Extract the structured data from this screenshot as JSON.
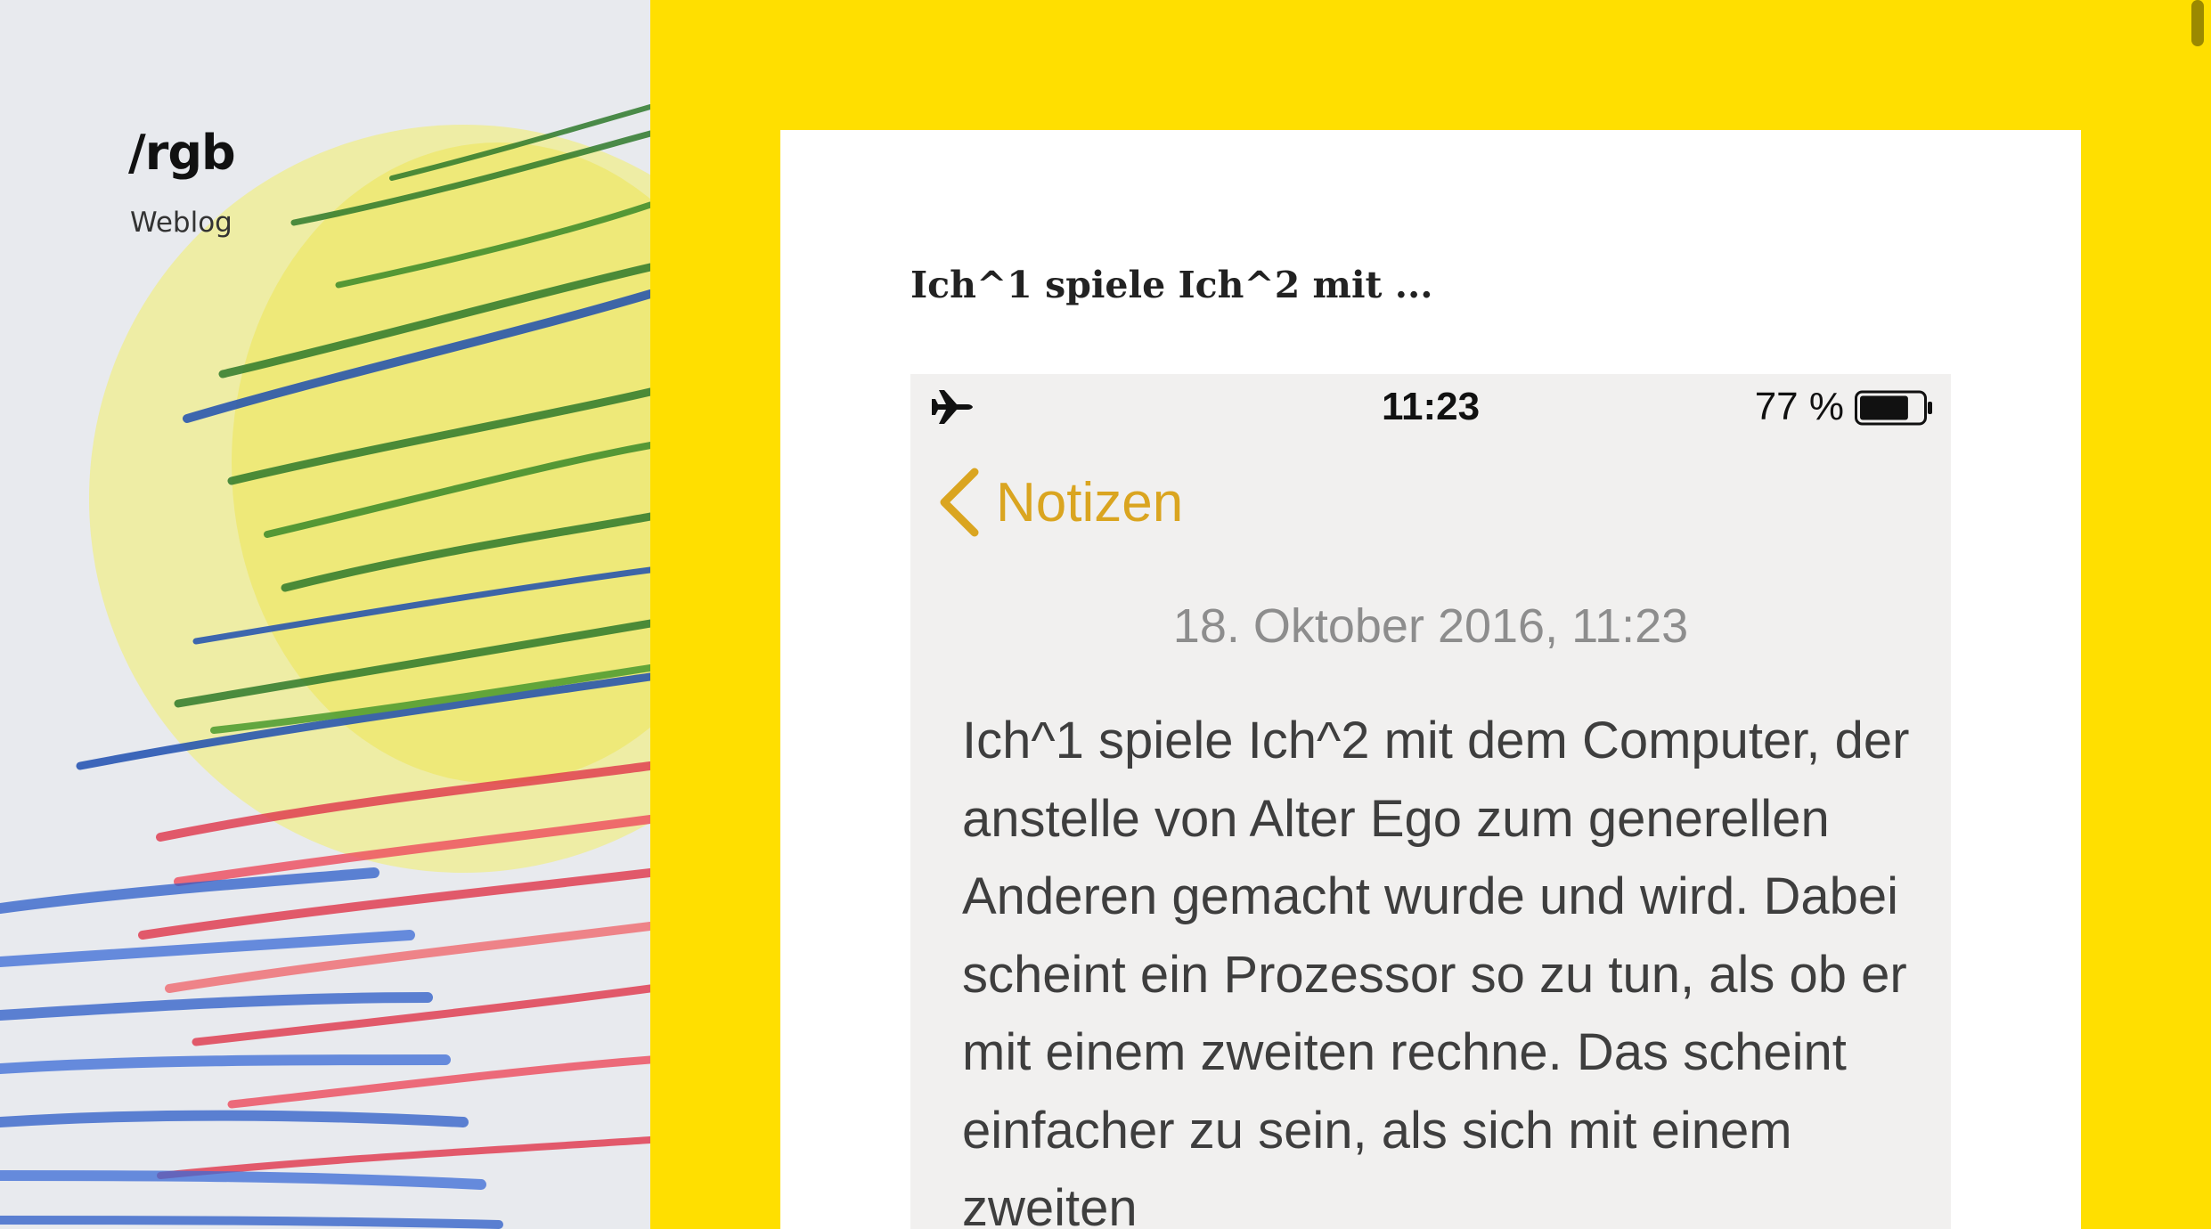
{
  "sidebar": {
    "site_title": "/rgb",
    "site_description": "Weblog"
  },
  "post": {
    "title": "Ich^1 spiele Ich^2 mit ..."
  },
  "phone": {
    "status_bar": {
      "mode_icon": "airplane-icon",
      "time": "11:23",
      "battery_percent": "77 %",
      "battery_icon": "battery-icon",
      "battery_level": 0.77
    },
    "nav": {
      "back_icon": "chevron-left-icon",
      "back_label": "Notizen"
    },
    "note": {
      "date": "18. Oktober 2016, 11:23",
      "body": "Ich^1 spiele Ich^2 mit dem Computer, der anstelle von Alter Ego zum generellen Anderen gemacht wurde und wird. Dabei scheint ein Prozessor so zu tun, als ob er mit einem zweiten rechne. Das scheint einfacher zu sein, als sich mit einem zweiten"
    }
  },
  "colors": {
    "page_background": "#FFDF00",
    "card_background": "#FFFFFF",
    "note_accent": "#DAA520",
    "note_background": "#F1F0EF"
  }
}
